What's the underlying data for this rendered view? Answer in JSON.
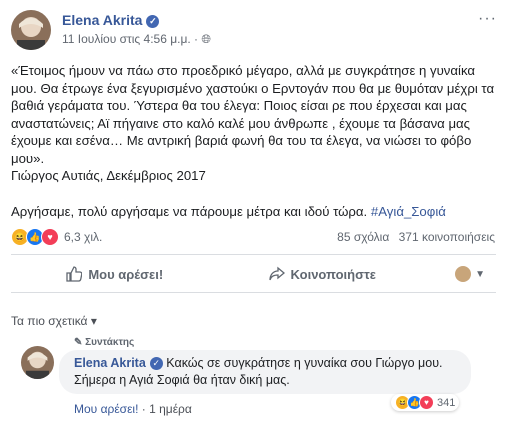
{
  "post": {
    "author": "Elena Akrita",
    "date": "11 Ιουλίου στις 4:56 μ.μ.",
    "privacy_icon": "globe-icon",
    "body": "«Έτοιμος ήμουν να πάω στο προεδρικό μέγαρο, αλλά με συγκράτησε η γυναίκα μου. Θα έτρωγε ένα ξεγυρισμένο χαστούκι ο Ερντογάν που θα με θυμόταν μέχρι τα βαθιά γεράματα του. Ύστερα θα του έλεγα: Ποιος είσαι ρε που έρχεσαι και μας αναστατώνεις; Αϊ πήγαινε στο καλό καλέ μου άνθρωπε , έχουμε τα βάσανα μας έχουμε και εσένα… Με αντρική βαριά φωνή θα του τα έλεγα, να νιώσει το φόβο μου».",
    "signature": "Γιώργος Αυτιάς, Δεκέμβριος 2017",
    "tail_text": "Αργήσαμε, πολύ αργήσαμε να πάρουμε μέτρα και ιδού τώρα.",
    "hashtag": "#Αγιά_Σοφιά",
    "reaction_count": "6,3 χιλ.",
    "comments": "85 σχόλια",
    "shares": "371 κοινοποιήσεις"
  },
  "actions": {
    "like": "Μου αρέσει!",
    "share": "Κοινοποιήστε"
  },
  "comments_section": {
    "sort_label": "Τα πιο σχετικά ▾",
    "badge": "Συντάκτης",
    "comment": {
      "author": "Elena Akrita",
      "text": "Κακώς σε συγκράτησε η γυναίκα σου Γιώργο μου. Σήμερα η Αγιά Σοφιά θα ήταν δική μας.",
      "reaction_count": "341",
      "like_label": "Μου αρέσει!",
      "separator": " · ",
      "time": "1 ημέρα"
    }
  },
  "colors": {
    "link": "#385898",
    "like": "#1877f2",
    "love": "#f33e58",
    "haha": "#f7b125"
  }
}
